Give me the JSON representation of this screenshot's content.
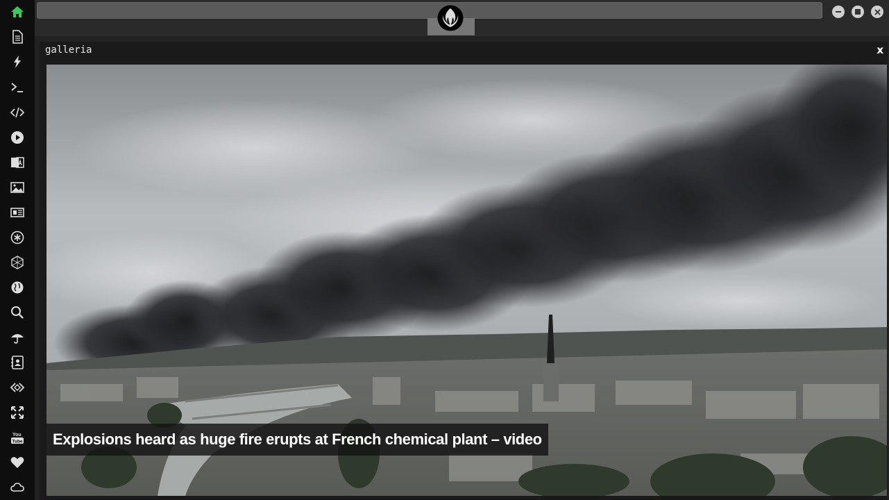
{
  "sidebar": {
    "items": [
      {
        "icon": "home-icon",
        "color": "#3cc85a"
      },
      {
        "icon": "document-icon"
      },
      {
        "icon": "lightning-icon"
      },
      {
        "icon": "terminal-icon",
        "text": ">_"
      },
      {
        "icon": "code-icon",
        "text": "</>"
      },
      {
        "icon": "play-icon"
      },
      {
        "icon": "translate-icon"
      },
      {
        "icon": "image-icon"
      },
      {
        "icon": "news-icon"
      },
      {
        "icon": "asterisk-icon"
      },
      {
        "icon": "hexagon-network-icon"
      },
      {
        "icon": "globe-icon"
      },
      {
        "icon": "search-icon"
      },
      {
        "icon": "umbrella-icon"
      },
      {
        "icon": "contact-card-icon"
      },
      {
        "icon": "diamond-code-icon"
      },
      {
        "icon": "expand-arrows-icon"
      },
      {
        "icon": "youtube-icon",
        "text": "You\nTube"
      },
      {
        "icon": "heart-icon"
      },
      {
        "icon": "cloud-icon"
      }
    ]
  },
  "topbar": {
    "address_value": "",
    "logo_icon": "rebel-alliance-logo-icon",
    "window_controls": [
      "minimize-icon",
      "maximize-icon",
      "close-icon"
    ]
  },
  "gallery": {
    "title": "galleria",
    "close_label": "x",
    "caption": "Explosions heard as huge fire erupts at French chemical plant – video"
  }
}
